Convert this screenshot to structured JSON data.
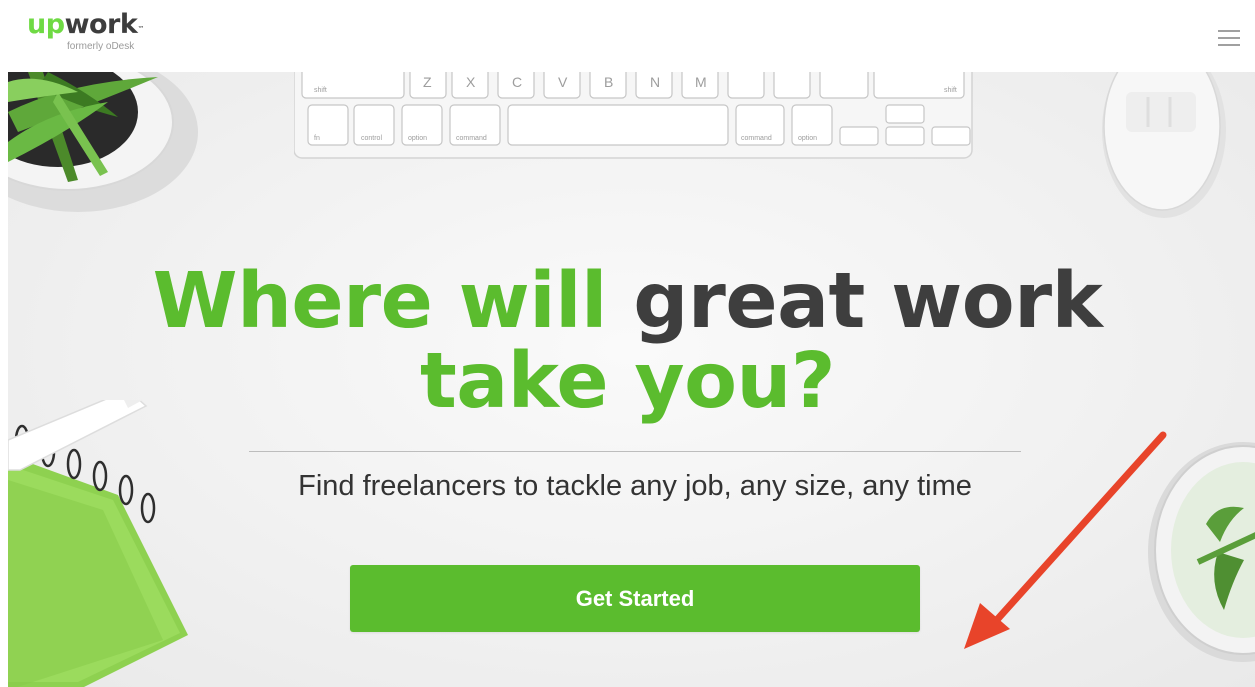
{
  "header": {
    "logo": {
      "brand_up": "up",
      "brand_work": "work",
      "trademark": "™",
      "tagline": "formerly oDesk"
    },
    "menu_icon": "hamburger-menu-icon"
  },
  "hero": {
    "headline": {
      "line1_green": "Where will",
      "line1_dark": "great work",
      "line2_green": "take you?"
    },
    "subheadline": "Find freelancers to tackle any job, any size, any time",
    "cta_label": "Get Started"
  },
  "keyboard": {
    "row1": [
      "shift",
      "Z",
      "X",
      "C",
      "V",
      "B",
      "N",
      "M",
      "<",
      ">",
      "/",
      "shift"
    ],
    "row2": [
      "fn",
      "control",
      "option",
      "command",
      "",
      "command",
      "option"
    ]
  },
  "colors": {
    "brand_green": "#6fda44",
    "headline_green": "#5bbc2e",
    "headline_dark": "#3e3e3e",
    "button_green": "#5bbc2e",
    "arrow_red": "#e8442a",
    "notebook_green": "#8ed150"
  }
}
